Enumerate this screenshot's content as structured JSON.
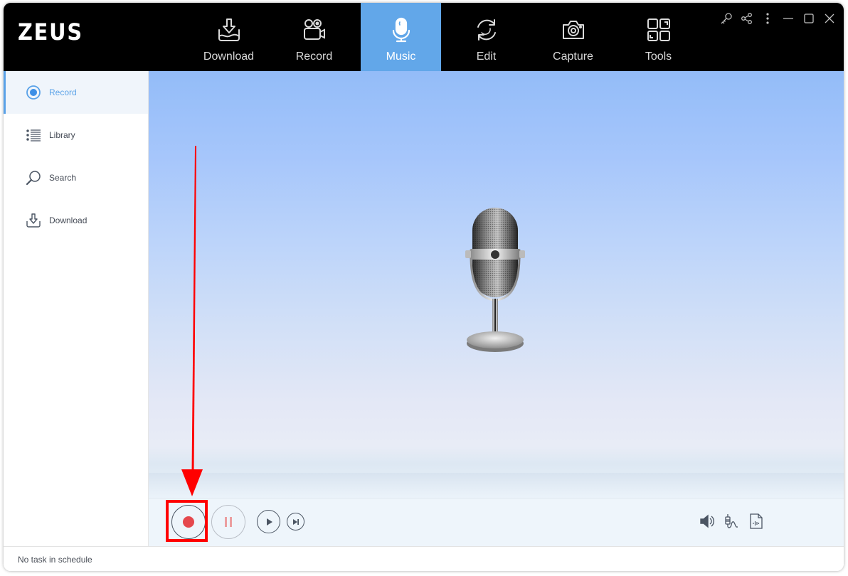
{
  "app": {
    "logo": "ZEUS",
    "accent_color": "#62a7e9",
    "record_color": "#e5484d"
  },
  "nav": {
    "tabs": [
      {
        "label": "Download",
        "icon": "download-tray-icon",
        "active": false
      },
      {
        "label": "Record",
        "icon": "video-camera-icon",
        "active": false
      },
      {
        "label": "Music",
        "icon": "microphone-icon",
        "active": true
      },
      {
        "label": "Edit",
        "icon": "refresh-cycle-icon",
        "active": false
      },
      {
        "label": "Capture",
        "icon": "camera-icon",
        "active": false
      },
      {
        "label": "Tools",
        "icon": "tools-grid-icon",
        "active": false
      }
    ]
  },
  "window_controls": [
    "key-icon",
    "share-icon",
    "more-vertical-icon",
    "minimize-icon",
    "maximize-icon",
    "close-icon"
  ],
  "sidebar": {
    "items": [
      {
        "label": "Record",
        "icon": "radio-record-icon",
        "active": true
      },
      {
        "label": "Library",
        "icon": "list-icon",
        "active": false
      },
      {
        "label": "Search",
        "icon": "search-icon",
        "active": false
      },
      {
        "label": "Download",
        "icon": "download-icon",
        "active": false
      }
    ]
  },
  "player": {
    "buttons": [
      "record",
      "pause",
      "play",
      "skip-next"
    ],
    "right_icons": [
      "speaker-icon",
      "audio-jack-icon",
      "audio-file-icon"
    ]
  },
  "status": {
    "text": "No task in schedule"
  },
  "annotation": {
    "color": "#ff0000",
    "target": "record-button"
  }
}
